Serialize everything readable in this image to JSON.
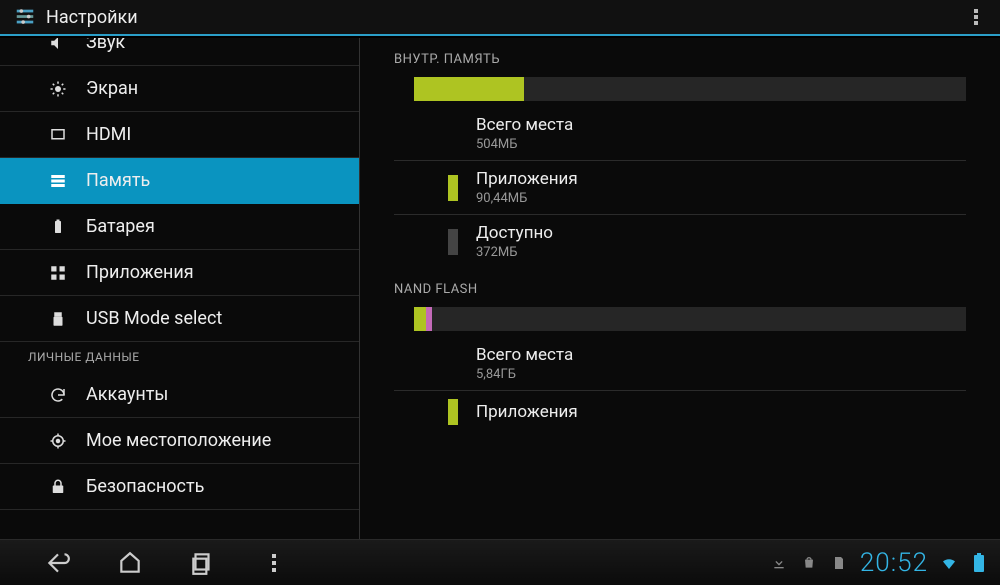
{
  "header": {
    "title": "Настройки"
  },
  "sidebar": {
    "items": [
      {
        "label": "Звук",
        "icon": "volume-icon",
        "partial": true
      },
      {
        "label": "Экран",
        "icon": "brightness-icon"
      },
      {
        "label": "HDMI",
        "icon": "hdmi-icon"
      },
      {
        "label": "Память",
        "icon": "storage-icon",
        "selected": true
      },
      {
        "label": "Батарея",
        "icon": "battery-icon"
      },
      {
        "label": "Приложения",
        "icon": "apps-icon"
      },
      {
        "label": "USB Mode select",
        "icon": "usb-icon"
      }
    ],
    "section": "ЛИЧНЫЕ ДАННЫЕ",
    "items2": [
      {
        "label": "Аккаунты",
        "icon": "sync-icon"
      },
      {
        "label": "Мое местоположение",
        "icon": "location-icon"
      },
      {
        "label": "Безопасность",
        "icon": "lock-icon"
      }
    ]
  },
  "storage": {
    "internal": {
      "title": "ВНУТР. ПАМЯТЬ",
      "bar": {
        "segments": [
          {
            "color": "#aec422",
            "width_pct": 20
          }
        ]
      },
      "total": {
        "label": "Всего места",
        "value": "504МБ"
      },
      "apps": {
        "label": "Приложения",
        "value": "90,44МБ",
        "swatch": "#aec422"
      },
      "avail": {
        "label": "Доступно",
        "value": "372МБ",
        "swatch": "#444"
      }
    },
    "nand": {
      "title": "NAND FLASH",
      "bar": {
        "segments": [
          {
            "color": "#aec422",
            "width_pct": 2.2
          },
          {
            "color": "#c36ab8",
            "width_pct": 1.0
          }
        ]
      },
      "total": {
        "label": "Всего места",
        "value": "5,84ГБ"
      },
      "apps": {
        "label": "Приложения",
        "value": ""
      }
    }
  },
  "navbar": {
    "clock": "20:52"
  }
}
